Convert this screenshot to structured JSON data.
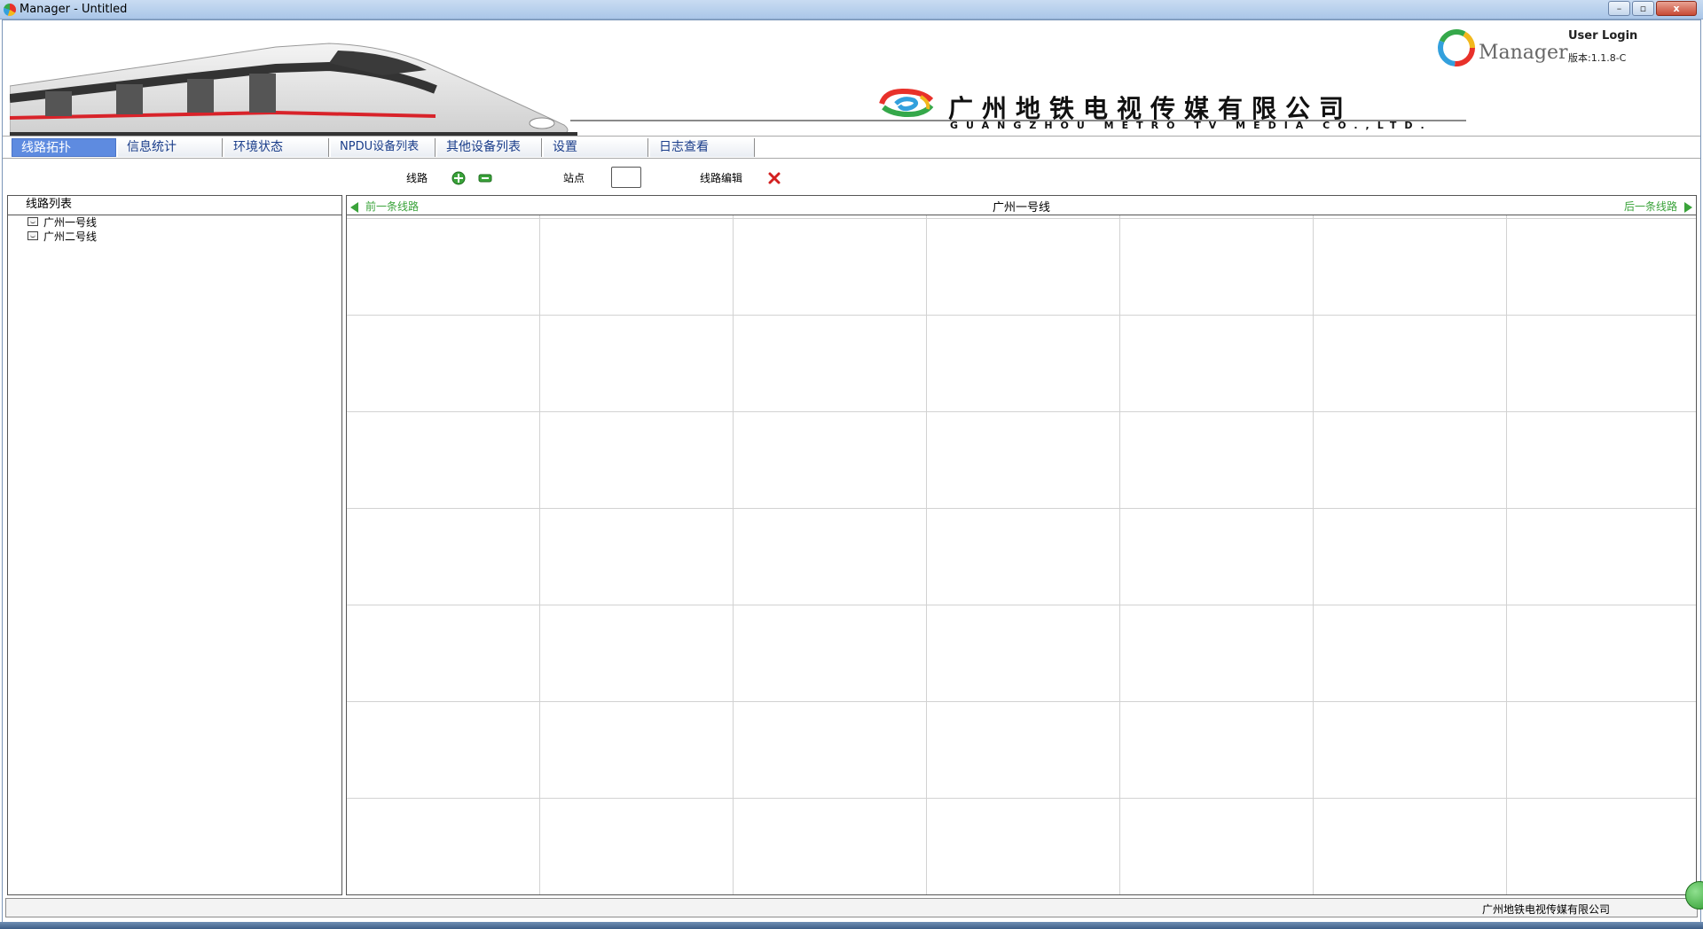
{
  "window": {
    "title": "Manager - Untitled",
    "minimize_label": "–",
    "maximize_label": "▫",
    "close_label": "x"
  },
  "banner": {
    "company_name_cn": "广州地铁电视传媒有限公司",
    "company_name_en": "GUANGZHOU METRO TV MEDIA CO.,LTD.",
    "manager_text": "Manager",
    "user_login": "User Login",
    "version": "版本:1.1.8-C"
  },
  "tabs": [
    {
      "label": "线路拓扑",
      "active": true
    },
    {
      "label": "信息统计",
      "active": false
    },
    {
      "label": "环境状态",
      "active": false
    },
    {
      "label": "NPDU设备列表",
      "active": false
    },
    {
      "label": "其他设备列表",
      "active": false
    },
    {
      "label": "设置",
      "active": false
    },
    {
      "label": "日志查看",
      "active": false
    }
  ],
  "toolbar": {
    "line_label": "线路",
    "station_label": "站点",
    "line_edit_label": "线路编辑",
    "add_icon": "add-icon",
    "remove_icon": "remove-icon",
    "delete_icon": "delete-icon"
  },
  "left_panel": {
    "header": "线路列表",
    "items": [
      "广州一号线",
      "广州二号线"
    ]
  },
  "main_panel": {
    "title": "广州一号线",
    "prev_label": "前一条线路",
    "next_label": "后一条线路"
  },
  "status": {
    "company": "广州地铁电视传媒有限公司"
  },
  "colors": {
    "active_tab": "#5e8be0",
    "nav_green": "#3aa33a",
    "delete_red": "#d32020"
  }
}
